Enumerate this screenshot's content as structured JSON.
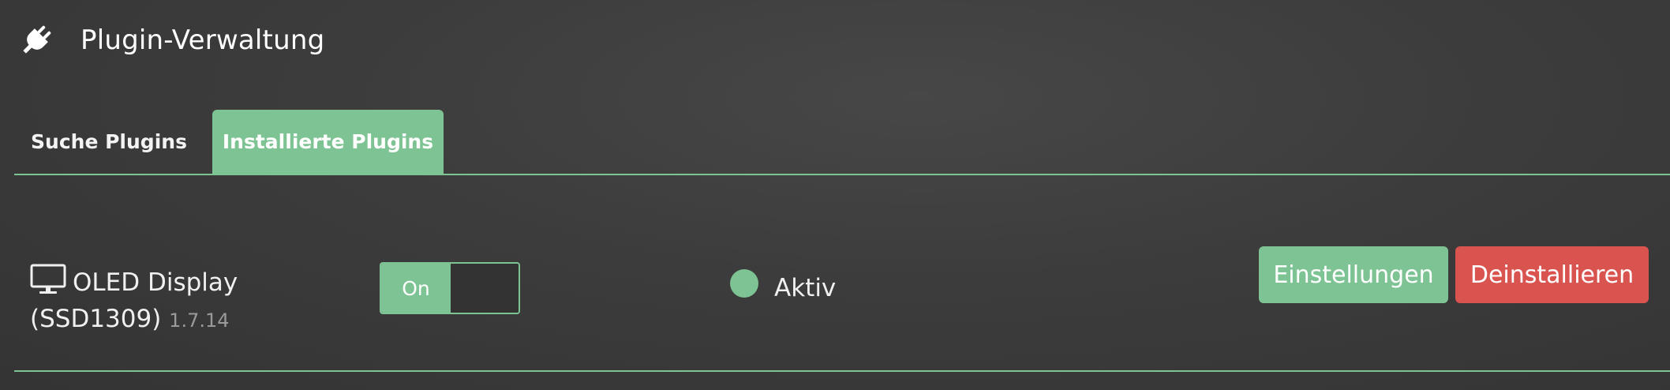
{
  "header": {
    "icon": "plug-icon",
    "title": "Plugin-Verwaltung"
  },
  "tabs": [
    {
      "label": "Suche Plugins",
      "active": false
    },
    {
      "label": "Installierte Plugins",
      "active": true
    }
  ],
  "plugins": [
    {
      "icon": "monitor-icon",
      "name": "OLED Display (SSD1309)",
      "version": "1.7.14",
      "toggle": {
        "label": "On",
        "state": "on"
      },
      "status": {
        "label": "Aktiv",
        "color": "#7ec393"
      },
      "actions": {
        "settings_label": "Einstellungen",
        "uninstall_label": "Deinstallieren"
      }
    }
  ],
  "colors": {
    "accent": "#7ec393",
    "danger": "#d9534f",
    "background": "#3c3c3c"
  }
}
